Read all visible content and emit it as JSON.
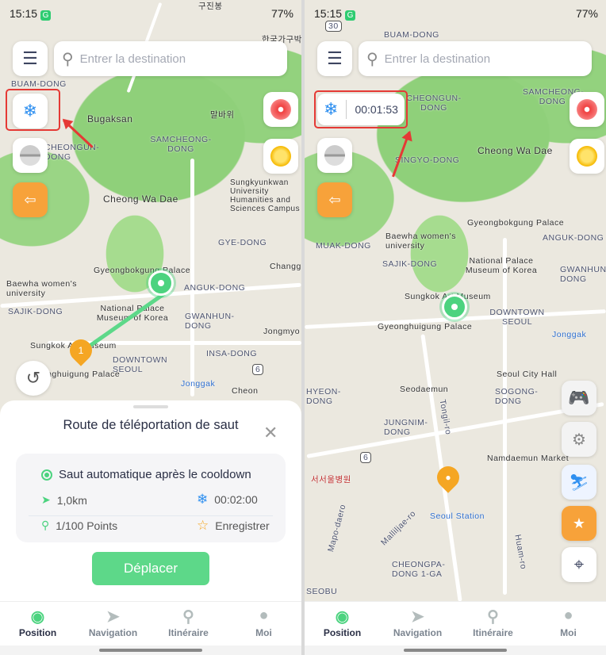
{
  "status": {
    "time": "15:15",
    "battery": "77%"
  },
  "search": {
    "placeholder": "Entrer la destination"
  },
  "colors": {
    "accent": "#5dd889",
    "highlight": "#e53935",
    "route_pin": "#f5a623"
  },
  "left_map_labels": [
    "구진봉",
    "BUAM-DONG",
    "Bugaksan",
    "말바위",
    "SAMCHEONG-DONG",
    "CHEONGUN-DONG",
    "Cheong Wa Dae",
    "Sungkyunkwan University Humanities and Sciences Campus",
    "GYE-DONG",
    "Gyeongbokgung Palace",
    "ANGUK-DONG",
    "Baewha women's university",
    "SAJIK-DONG",
    "National Palace Museum of Korea",
    "GWANHUN-DONG",
    "INSA-DONG",
    "Sungkok Art Museum",
    "Gyeonghuigung Palace",
    "DOWNTOWN SEOUL",
    "Jonggak",
    "Jongmyo",
    "Changg",
    "Cheon",
    "한국가구박"
  ],
  "right_map_labels": [
    "BUAM-DONG",
    "CHEONGUN-DONG",
    "SAMCHEONG-DONG",
    "Cheong Wa Dae",
    "SINGYO-DONG",
    "Gyeongbokgung Palace",
    "ANGUK-DONG",
    "Baewha women's university",
    "MUAK-DONG",
    "SAJIK-DONG",
    "National Palace Museum of Korea",
    "GWANHUN-DONG",
    "Sungkok Art Museum",
    "Gyeonghuigung Palace",
    "DOWNTOWN SEOUL",
    "Jonggak",
    "Seodaemun",
    "Seoul City Hall",
    "SOGONG-DONG",
    "HYEON-DONG",
    "JUNGNIM-DONG",
    "Namdaemun Market",
    "서서울병원",
    "Seoul Station",
    "Mapo-daero",
    "Malliljae-ro",
    "Tongil-ro",
    "Huam-ro",
    "CHEONGPA-DONG 1-GA",
    "SEOBU"
  ],
  "route_sheet": {
    "title": "Route de téléportation de saut",
    "auto_jump": "Saut automatique après le cooldown",
    "distance": "1,0km",
    "cooldown": "00:02:00",
    "points": "1/100 Points",
    "save": "Enregistrer",
    "move_button": "Déplacer",
    "pin_number": "1"
  },
  "cooldown_timer": "00:01:53",
  "road_badges": [
    "6",
    "30"
  ],
  "tabs": [
    {
      "label": "Position",
      "icon": "location-pin",
      "active": true
    },
    {
      "label": "Navigation",
      "icon": "paper-plane"
    },
    {
      "label": "Itinéraire",
      "icon": "route"
    },
    {
      "label": "Moi",
      "icon": "user"
    }
  ]
}
